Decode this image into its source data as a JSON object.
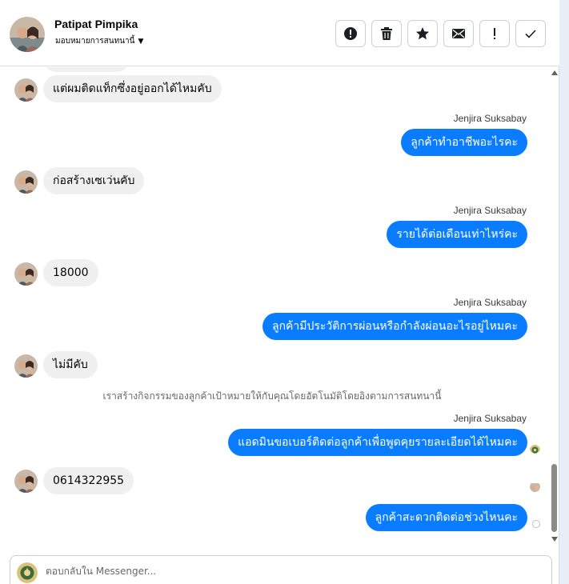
{
  "header": {
    "contact_name": "Patipat Pimpika",
    "assign_label": "มอบหมายการสนทนานี้"
  },
  "toolbar": {
    "buttons": [
      {
        "name": "spam-button",
        "icon": "alert-circle-icon"
      },
      {
        "name": "delete-button",
        "icon": "trash-icon"
      },
      {
        "name": "star-button",
        "icon": "star-icon"
      },
      {
        "name": "mark-unread-button",
        "icon": "envelope-icon"
      },
      {
        "name": "follow-up-button",
        "icon": "exclamation-icon"
      },
      {
        "name": "mark-done-button",
        "icon": "check-icon"
      }
    ]
  },
  "messages": [
    {
      "type": "in",
      "text": "แต่ผมติดแท็กซึ่งอยู่ออกได้ไหมคับ"
    },
    {
      "type": "out",
      "sender": "Jenjira Suksabay",
      "text": "ลูกค้าทำอาชีพอะไรคะ"
    },
    {
      "type": "in",
      "text": "ก่อสร้างเซเว่นคับ"
    },
    {
      "type": "out",
      "sender": "Jenjira Suksabay",
      "text": "รายได้ต่อเดือนเท่าไหร่คะ"
    },
    {
      "type": "in",
      "text": "18000"
    },
    {
      "type": "out",
      "sender": "Jenjira Suksabay",
      "text": "ลูกค้ามีประวัติการผ่อนหรือกำลังผ่อนอะไรอยู่ไหมคะ"
    },
    {
      "type": "in",
      "text": "ไม่มีคับ"
    },
    {
      "type": "system",
      "text": "เราสร้างกิจกรรมของลูกค้าเป้าหมายให้กับคุณโดยอัตโนมัติโดยอิงตามการสนทนานี้"
    },
    {
      "type": "out",
      "sender": "Jenjira Suksabay",
      "text": "แอดมินขอเบอร์ติดต่อลูกค้าเพื่อพูดคุยรายละเอียดได้ไหมคะ"
    },
    {
      "type": "in",
      "text": "0614322955"
    },
    {
      "type": "out",
      "text": "ลูกค้าสะดวกติดต่อช่วงไหนคะ"
    }
  ],
  "composer": {
    "placeholder": "ตอบกลับใน Messenger..."
  },
  "colors": {
    "outgoing_bubble": "#0a7cff",
    "incoming_bubble": "#f0f0f0"
  }
}
